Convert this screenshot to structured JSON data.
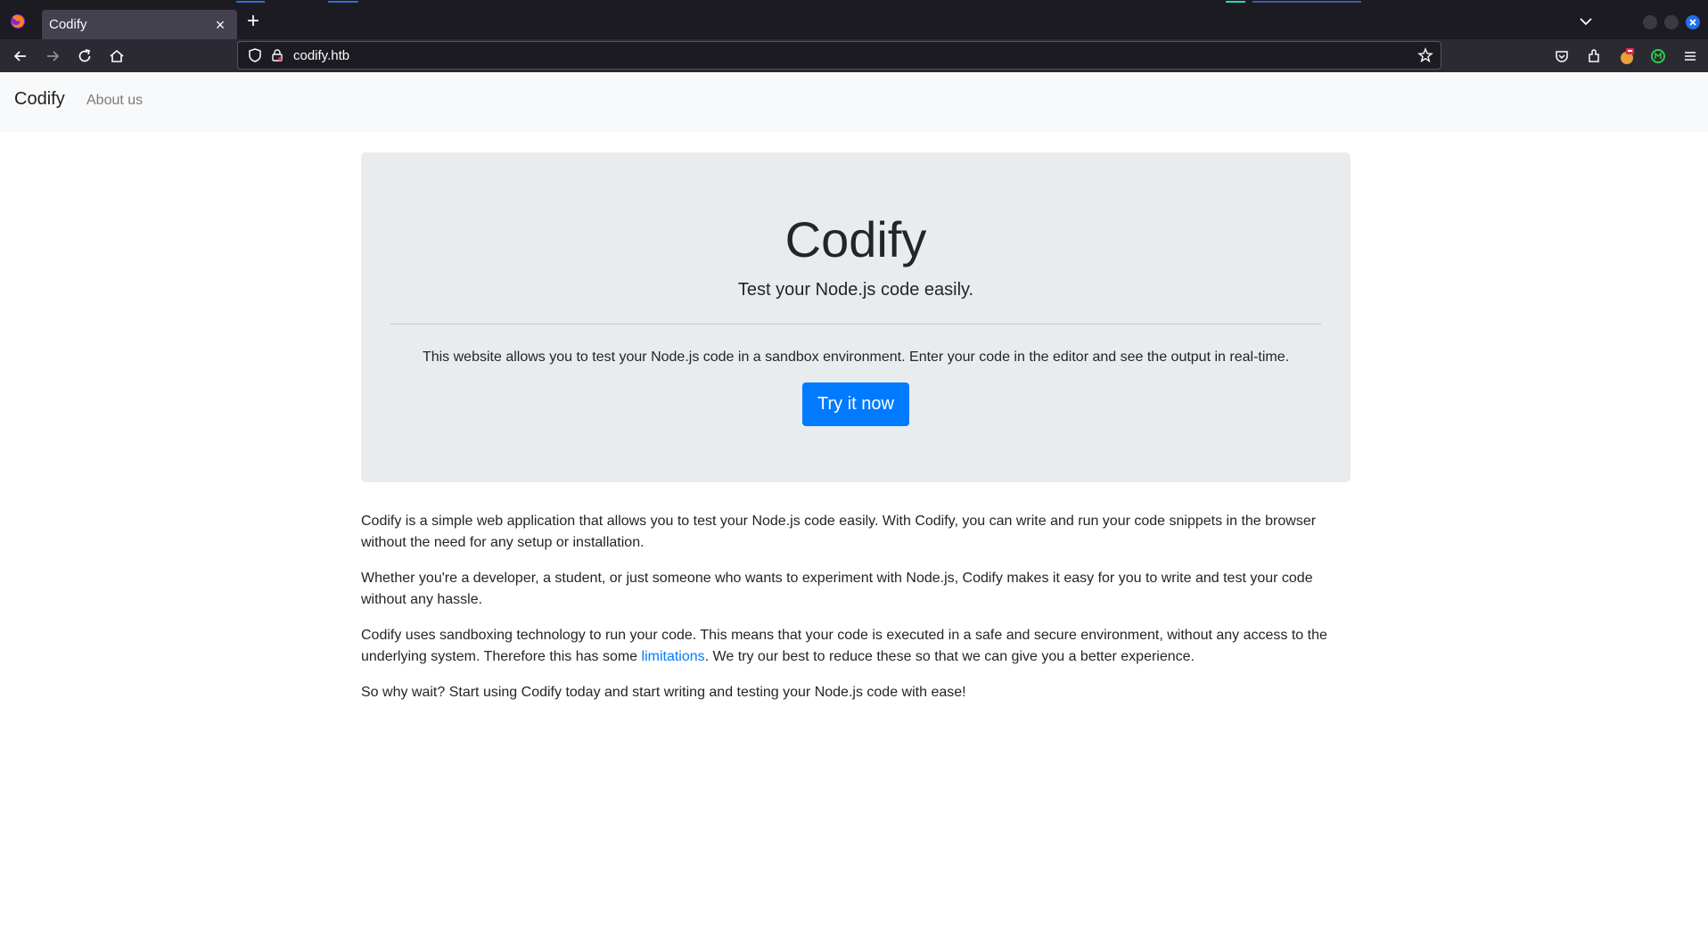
{
  "browser": {
    "tab_title": "Codify",
    "tab_close": "×",
    "new_tab": "+",
    "url": "codify.htb"
  },
  "navbar": {
    "brand": "Codify",
    "about_link": "About us"
  },
  "hero": {
    "title": "Codify",
    "lead": "Test your Node.js code easily.",
    "description": "This website allows you to test your Node.js code in a sandbox environment. Enter your code in the editor and see the output in real-time.",
    "button": "Try it now"
  },
  "content": {
    "p1": "Codify is a simple web application that allows you to test your Node.js code easily. With Codify, you can write and run your code snippets in the browser without the need for any setup or installation.",
    "p2": "Whether you're a developer, a student, or just someone who wants to experiment with Node.js, Codify makes it easy for you to write and test your code without any hassle.",
    "p3_before": "Codify uses sandboxing technology to run your code. This means that your code is executed in a safe and secure environment, without any access to the underlying system. Therefore this has some ",
    "p3_link": "limitations",
    "p3_after": ". We try our best to reduce these so that we can give you a better experience.",
    "p4": "So why wait? Start using Codify today and start writing and testing your Node.js code with ease!"
  },
  "colors": {
    "primary": "#007bff",
    "jumbotron_bg": "#e9ecef",
    "navbar_bg": "#f8f9fa",
    "chrome_dark": "#1c1b22",
    "chrome_toolbar": "#2b2a33"
  },
  "icons": [
    "firefox-icon",
    "close-icon",
    "plus-icon",
    "chevron-down-icon",
    "back-arrow-icon",
    "forward-arrow-icon",
    "reload-icon",
    "home-icon",
    "shield-icon",
    "lock-icon",
    "star-icon",
    "pocket-icon",
    "extensions-icon",
    "fox-extension-icon",
    "green-extension-icon",
    "hamburger-menu-icon"
  ]
}
